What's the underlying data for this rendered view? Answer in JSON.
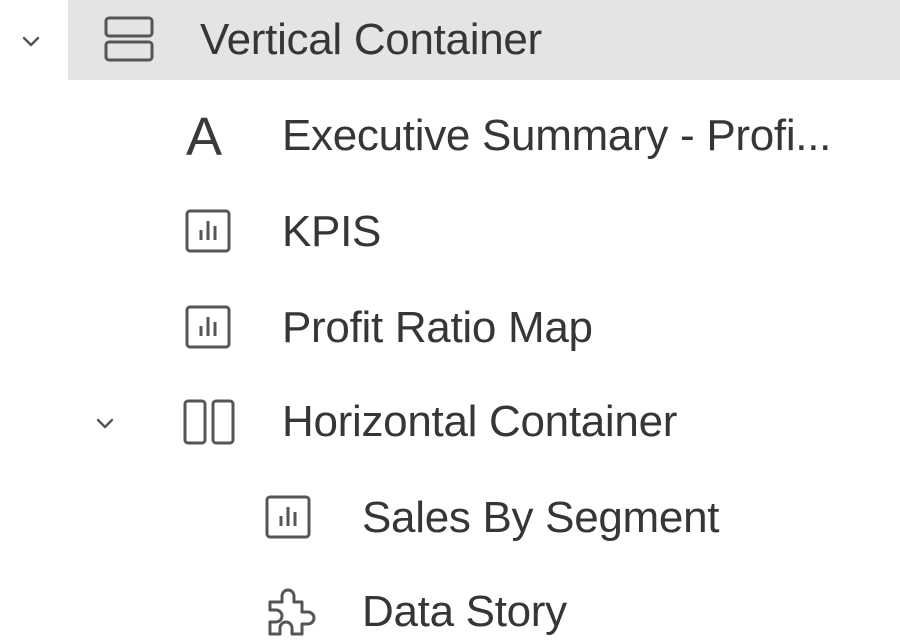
{
  "tree": {
    "items": [
      {
        "label": "Vertical Container",
        "icon": "vertical-container-icon",
        "expanded": true,
        "selected": true,
        "level": 0
      },
      {
        "label": "Executive Summary - Profi...",
        "icon": "text-object-icon",
        "glyph": "A",
        "level": 1
      },
      {
        "label": "KPIS",
        "icon": "worksheet-icon",
        "level": 1
      },
      {
        "label": "Profit Ratio Map",
        "icon": "worksheet-icon",
        "level": 1
      },
      {
        "label": "Horizontal Container",
        "icon": "horizontal-container-icon",
        "expanded": true,
        "level": 1
      },
      {
        "label": "Sales By Segment",
        "icon": "worksheet-icon",
        "level": 2
      },
      {
        "label": "Data Story",
        "icon": "extension-puzzle-icon",
        "level": 2
      }
    ]
  },
  "colors": {
    "selected_row": "#e4e4e4",
    "text": "#363636",
    "icon": "#555555"
  }
}
